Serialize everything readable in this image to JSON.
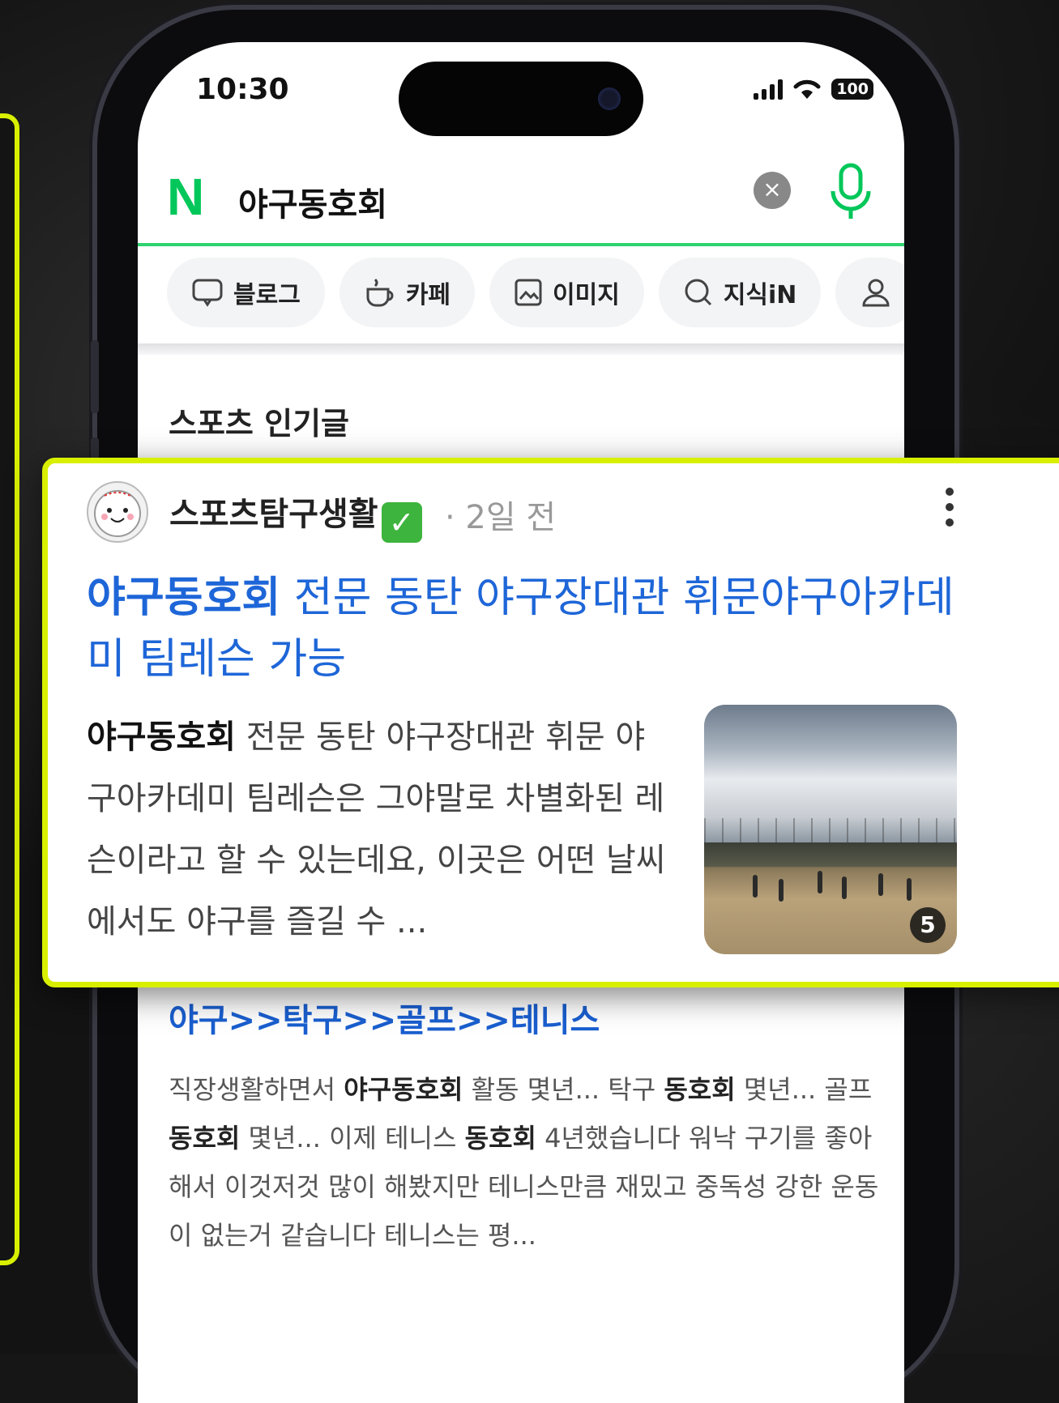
{
  "status_bar": {
    "time": "10:30",
    "battery": "100"
  },
  "search": {
    "query": "야구동호회",
    "logo": "N"
  },
  "tabs": [
    {
      "label": "블로그",
      "icon": "blog-icon"
    },
    {
      "label": "카페",
      "icon": "cafe-cup-icon"
    },
    {
      "label": "이미지",
      "icon": "image-icon"
    },
    {
      "label": "지식iN",
      "icon": "search-q-icon"
    }
  ],
  "section": {
    "title": "스포츠 인기글"
  },
  "popup_post": {
    "author": "스포츠탐구생활",
    "verified": "✅",
    "time": "· 2일 전",
    "title_highlight": "야구동호회",
    "title_rest": " 전문 동탄 야구장대관 휘문야구아카데미 팀레슨 가능",
    "snippet_highlight": "야구동호회",
    "snippet_rest": " 전문 동탄 야구장대관 휘문 야구아카데미 팀레슨은 그야말로 차별화된 레슨이라고 할 수 있는데요, 이곳은 어떤 날씨에서도 야구를 즐길 수 ...",
    "image_count": "5"
  },
  "second_post": {
    "title_highlight": "야구",
    "title_rest": ">>탁구>>골프>>테니스",
    "body_parts": [
      {
        "t": "직장생활하면서 ",
        "b": false
      },
      {
        "t": "야구동호회",
        "b": true
      },
      {
        "t": " 활동 몇년... 탁구 ",
        "b": false
      },
      {
        "t": "동호회",
        "b": true
      },
      {
        "t": " 몇년... 골프",
        "b": false
      },
      {
        "t": "동호회",
        "b": true
      },
      {
        "t": " 몇년... 이제 테니스 ",
        "b": false
      },
      {
        "t": "동호회",
        "b": true
      },
      {
        "t": " 4년했습니다 워낙 구기를 좋아해서 이것저것 많이 해봤지만 테니스만큼 재밌고 중독성 강한 운동이 없는거 같습니다 테니스는 평...",
        "b": false
      }
    ]
  },
  "colors": {
    "naver_green": "#03c75a",
    "link_blue": "#1e66d8",
    "highlight_border": "#d8f000"
  }
}
